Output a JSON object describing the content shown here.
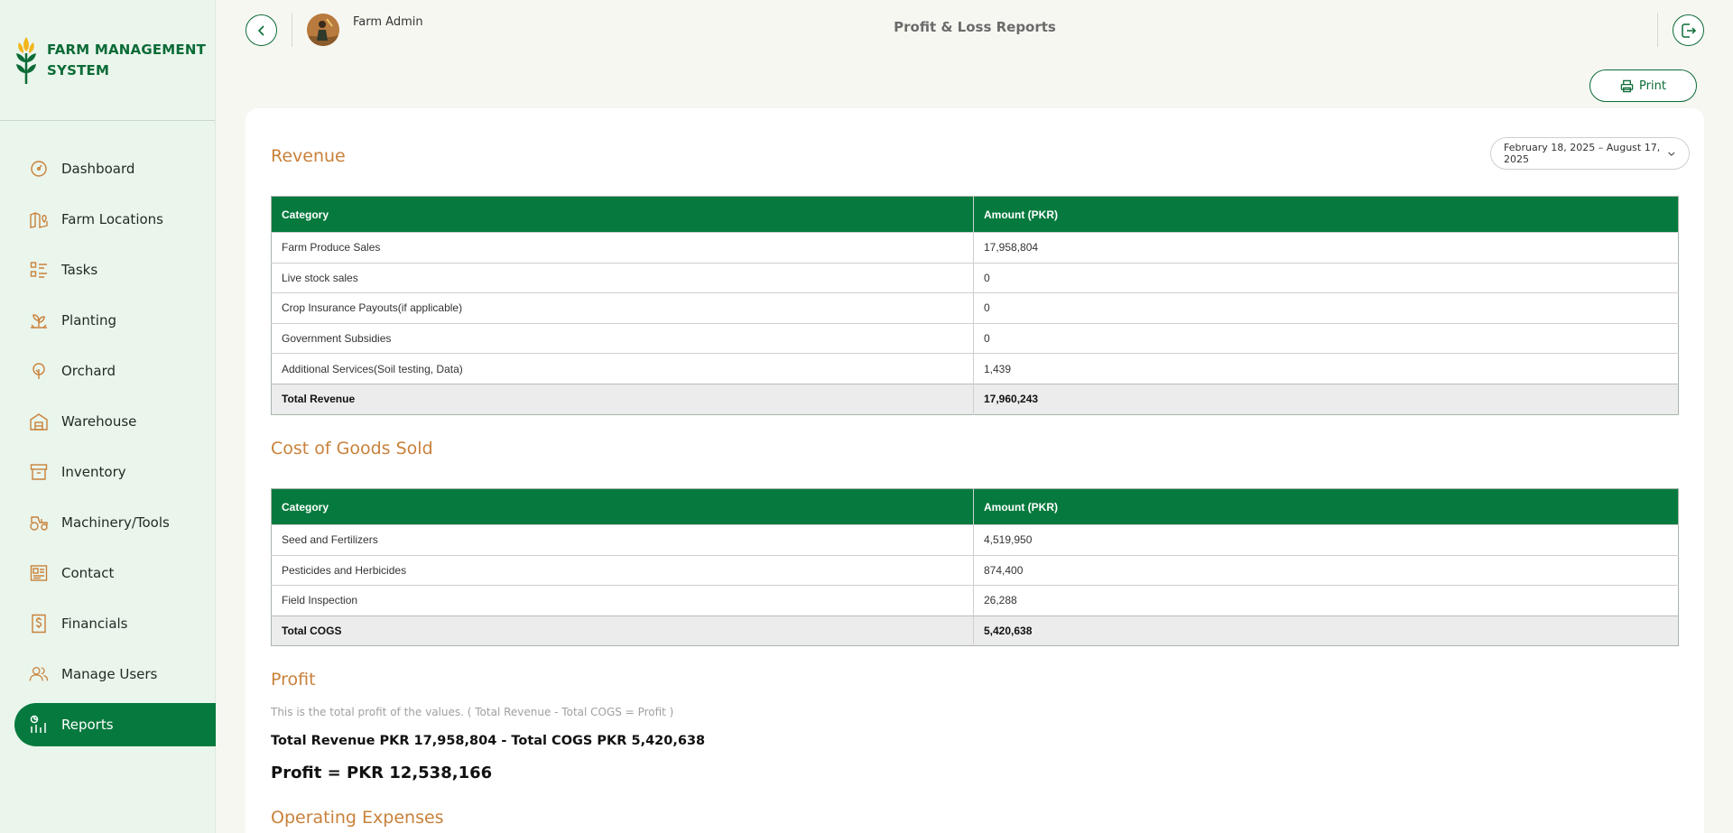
{
  "brand": {
    "line1": "FARM MANAGEMENT",
    "line2": "SYSTEM"
  },
  "colors": {
    "primary": "#067a3e",
    "accent": "#c9813a",
    "sidebar_bg": "#eaf5ec"
  },
  "sidebar": {
    "items": [
      {
        "label": "Dashboard",
        "icon": "gauge-icon"
      },
      {
        "label": "Farm Locations",
        "icon": "map-pin-icon"
      },
      {
        "label": "Tasks",
        "icon": "task-list-icon"
      },
      {
        "label": "Planting",
        "icon": "sprout-icon"
      },
      {
        "label": "Orchard",
        "icon": "tree-icon"
      },
      {
        "label": "Warehouse",
        "icon": "warehouse-icon"
      },
      {
        "label": "Inventory",
        "icon": "archive-box-icon"
      },
      {
        "label": "Machinery/Tools",
        "icon": "tractor-icon"
      },
      {
        "label": "Contact",
        "icon": "contact-card-icon"
      },
      {
        "label": "Financials",
        "icon": "dollar-receipt-icon"
      },
      {
        "label": "Manage Users",
        "icon": "users-icon"
      },
      {
        "label": "Reports",
        "icon": "report-chart-icon",
        "active": true
      }
    ]
  },
  "header": {
    "user_name": "Farm Admin",
    "page_title": "Profit & Loss Reports",
    "print_label": "Print"
  },
  "date_range": "February 18, 2025 – August 17, 2025",
  "revenue": {
    "title": "Revenue",
    "headers": [
      "Category",
      "Amount (PKR)"
    ],
    "rows": [
      [
        "Farm Produce Sales",
        "17,958,804"
      ],
      [
        "Live stock sales",
        "0"
      ],
      [
        "Crop Insurance Payouts(if applicable)",
        "0"
      ],
      [
        "Government Subsidies",
        "0"
      ],
      [
        "Additional Services(Soil testing, Data)",
        "1,439"
      ]
    ],
    "total": [
      "Total Revenue",
      "17,960,243"
    ]
  },
  "cogs": {
    "title": "Cost of Goods Sold",
    "headers": [
      "Category",
      "Amount (PKR)"
    ],
    "rows": [
      [
        "Seed and Fertilizers",
        "4,519,950"
      ],
      [
        "Pesticides and Herbicides",
        "874,400"
      ],
      [
        "Field Inspection",
        "26,288"
      ]
    ],
    "total": [
      "Total COGS",
      "5,420,638"
    ]
  },
  "profit": {
    "title": "Profit",
    "description": "This is the total profit of the values. ( Total Revenue - Total COGS = Profit )",
    "formula": "Total Revenue PKR 17,958,804 - Total COGS PKR 5,420,638",
    "value": "Profit = PKR 12,538,166"
  },
  "operating_expenses": {
    "title": "Operating Expenses"
  }
}
